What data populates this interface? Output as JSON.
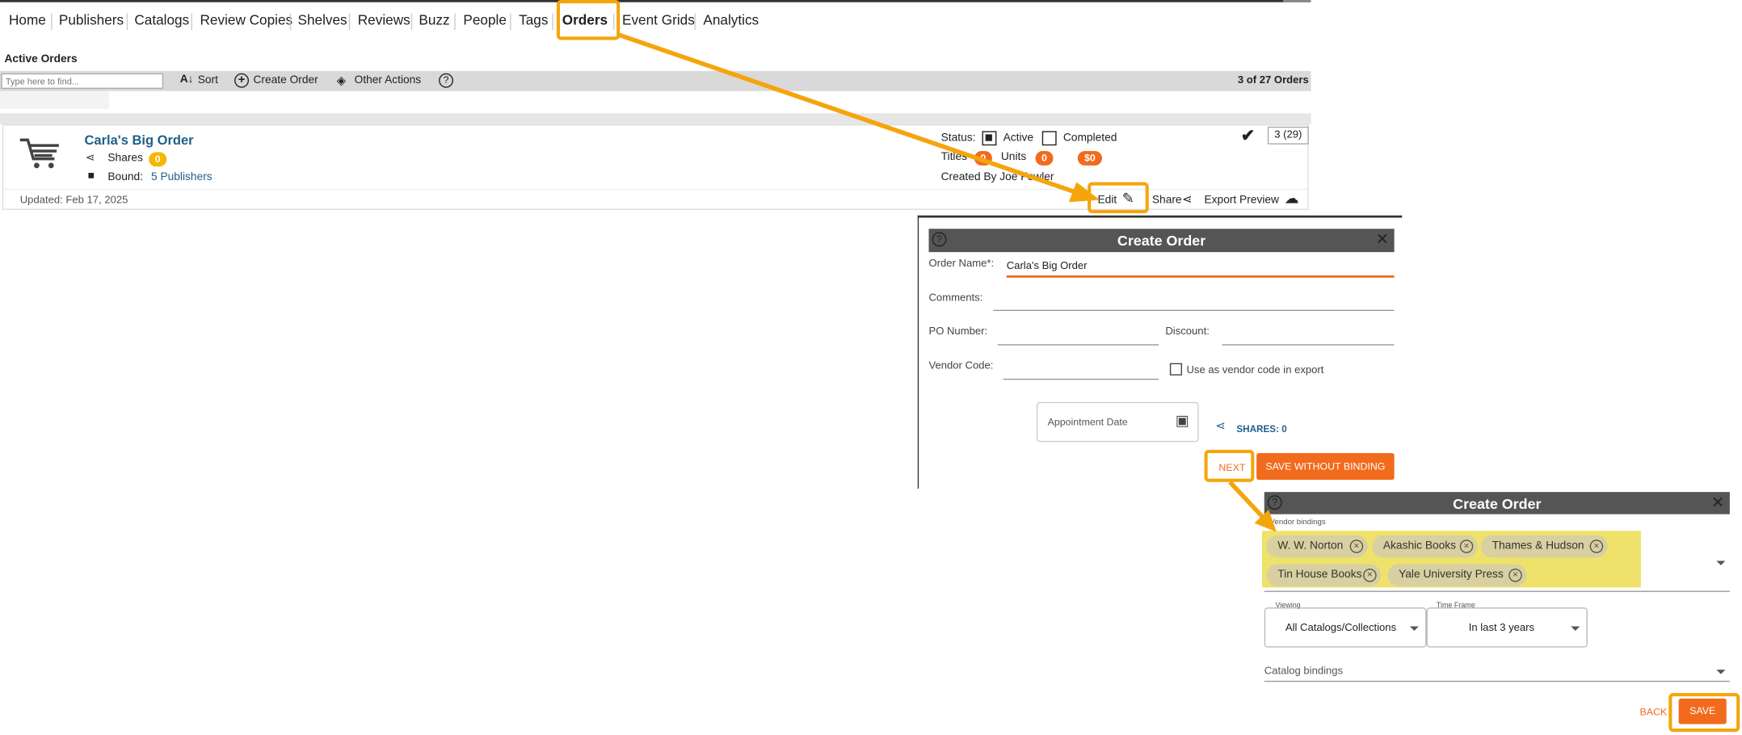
{
  "nav": {
    "items": [
      "Home",
      "Publishers",
      "Catalogs",
      "Review Copies",
      "Shelves",
      "Reviews",
      "Buzz",
      "People",
      "Tags",
      "Orders",
      "Event Grids",
      "Analytics"
    ],
    "active": "Orders"
  },
  "section_title": "Active Orders",
  "toolbar": {
    "search_placeholder": "Type here to find...",
    "sort_label": "Sort",
    "create_label": "Create Order",
    "other_label": "Other Actions",
    "count": "3 of 27 Orders"
  },
  "order": {
    "name": "Carla's Big Order",
    "shares_label": "Shares",
    "shares_count": "0",
    "bound_label": "Bound:",
    "bound_value": "5 Publishers",
    "status_label": "Status:",
    "active_label": "Active",
    "completed_label": "Completed",
    "titles_label": "Titles",
    "titles_count": "0",
    "units_label": "Units",
    "units_count": "0",
    "amount": "$0",
    "created_by": "Created By Joe Fowler",
    "count_box": "3 (29)",
    "updated": "Updated: Feb 17, 2025",
    "edit_label": "Edit",
    "share_label": "Share",
    "export_label": "Export Preview"
  },
  "dialog1": {
    "title": "Create Order",
    "order_name_label": "Order Name*:",
    "order_name_value": "Carla's Big Order",
    "comments_label": "Comments:",
    "po_label": "PO Number:",
    "discount_label": "Discount:",
    "vendor_label": "Vendor Code:",
    "vendor_checkbox_label": "Use as vendor code in export",
    "appointment_placeholder": "Appointment Date",
    "shares_label": "SHARES: 0",
    "next_label": "NEXT",
    "save_without_label": "SAVE WITHOUT BINDING"
  },
  "dialog2": {
    "title": "Create Order",
    "vendor_bindings_label": "Vendor bindings",
    "chips": [
      "W. W. Norton",
      "Akashic Books",
      "Thames & Hudson",
      "Tin House Books",
      "Yale University Press"
    ],
    "viewing_label": "Viewing",
    "viewing_value": "All Catalogs/Collections",
    "timeframe_label": "Time Frame",
    "timeframe_value": "In last 3 years",
    "catalog_bindings_label": "Catalog bindings",
    "back_label": "BACK",
    "save_label": "SAVE"
  },
  "colors": {
    "highlight": "#f5a50c",
    "accent_orange": "#f26b1d",
    "link_blue": "#1e5f8a",
    "dialog_header": "#555555",
    "chip_bg": "#d8d0a0",
    "chip_area": "#efe26a"
  }
}
